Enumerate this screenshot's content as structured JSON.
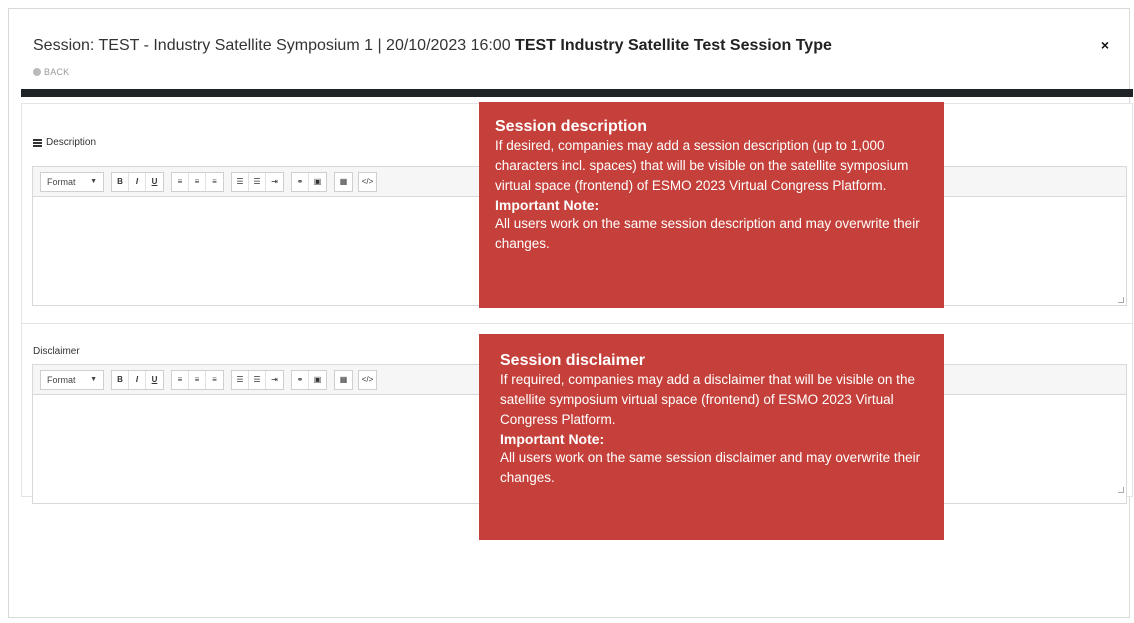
{
  "header": {
    "title_prefix": "Session: TEST - Industry Satellite Symposium 1 | 20/10/2023 16:00 ",
    "title_bold": "TEST Industry Satellite Test Session Type",
    "back_label": "BACK",
    "close_label": "×"
  },
  "description_panel": {
    "label": "Description",
    "format_label": "Format"
  },
  "disclaimer_panel": {
    "label": "Disclaimer",
    "format_label": "Format"
  },
  "toolbar": {
    "bold": "B",
    "italic": "I",
    "underline": "U",
    "align_left": "≡",
    "align_center": "≡",
    "align_right": "≡",
    "bullet_list": "☰",
    "numbered_list": "☰",
    "indent": "⇥",
    "link": "⚭",
    "image": "▣",
    "table": "▦",
    "source": "</>"
  },
  "tips": {
    "description": {
      "title": "Session description",
      "body": "If desired, companies may add a session description (up to 1,000 characters incl. spaces) that will be visible on the satellite symposium virtual space (frontend) of ESMO 2023 Virtual Congress Platform.",
      "note_title": "Important Note:",
      "note_body": "All users work on the same session description and may overwrite their changes."
    },
    "disclaimer": {
      "title": "Session disclaimer",
      "body": "If required, companies may add a disclaimer that will be visible on the satellite symposium  virtual space (frontend) of ESMO 2023 Virtual Congress Platform.",
      "note_title": "Important Note:",
      "note_body": "All users work on the same session disclaimer and may overwrite their changes."
    }
  },
  "colors": {
    "tip_background": "#c5403a",
    "dark_bar": "#1f2326"
  }
}
